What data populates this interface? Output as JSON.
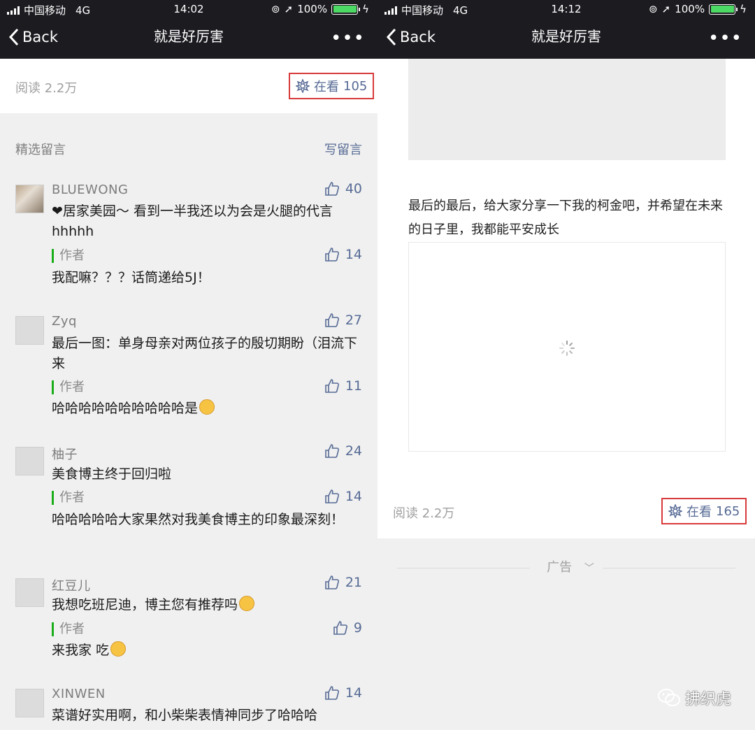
{
  "status_left": {
    "carrier": "中国移动",
    "network": "4G",
    "time": "14:02",
    "battery": "100%",
    "battery_level": 1.0
  },
  "status_right": {
    "carrier": "中国移动",
    "network": "4G",
    "time": "14:12",
    "battery": "100%",
    "battery_level": 1.0
  },
  "nav": {
    "back_label": "Back",
    "title": "就是好厉害",
    "more": "•••"
  },
  "left_stats": {
    "read_label": "阅读 2.2万",
    "inlook_label": "在看",
    "inlook_count": "105"
  },
  "comments_header": {
    "title": "精选留言",
    "write": "写留言"
  },
  "comments": [
    {
      "name": "BLUEWONG",
      "likes": "40",
      "text": "❤居家美园～ 看到一半我还以为会是火腿的代言hhhhh",
      "author_label": "作者",
      "reply_likes": "14",
      "reply": "我配嘛？？？话筒递给5J！"
    },
    {
      "name": "Zyq",
      "likes": "27",
      "text": "最后一图：单身母亲对两位孩子的殷切期盼（泪流下来",
      "author_label": "作者",
      "reply_likes": "11",
      "reply": "哈哈哈哈哈哈哈哈哈哈是"
    },
    {
      "name": "柚子",
      "likes": "24",
      "text": "美食博主终于回归啦",
      "author_label": "作者",
      "reply_likes": "14",
      "reply": "哈哈哈哈哈大家果然对我美食博主的印象最深刻！"
    },
    {
      "name": "红豆儿",
      "likes": "21",
      "text": "我想吃班尼迪，博主您有推荐吗",
      "author_label": "作者",
      "reply_likes": "9",
      "reply": "来我家 吃"
    },
    {
      "name": "XINWEN",
      "likes": "14",
      "text": "菜谱好实用啊，和小柴柴表情神同步了哈哈哈"
    }
  ],
  "right": {
    "paragraph": "最后的最后，给大家分享一下我的柯金吧，并希望在未来的日子里，我都能平安成长",
    "read_label": "阅读 2.2万",
    "inlook_label": "在看",
    "inlook_count": "165",
    "ad_label": "广告",
    "watermark": "拂织虎"
  },
  "colors": {
    "bar": "#1c1b20",
    "link": "#576b95",
    "highlight_box": "#d83a3a",
    "author_bar": "#1aad19"
  }
}
